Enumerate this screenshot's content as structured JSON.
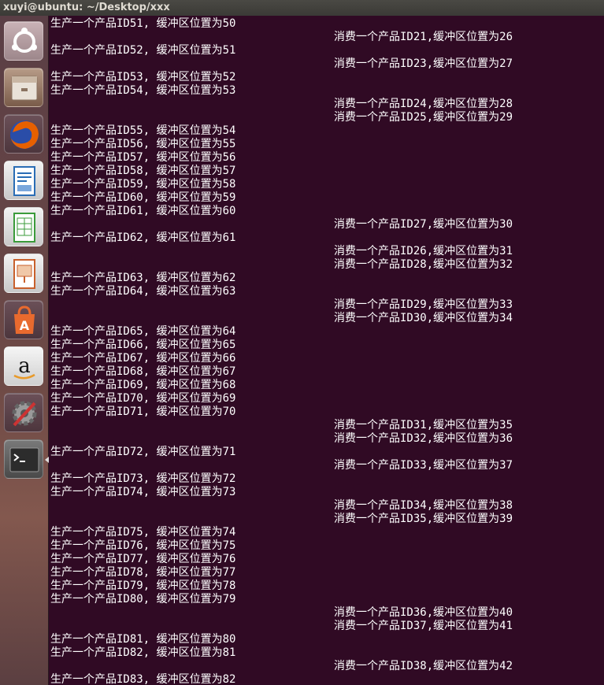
{
  "window": {
    "title": "xuyi@ubuntu: ~/Desktop/xxx"
  },
  "launcher": {
    "items": [
      {
        "name": "ubuntu-dash-icon",
        "color": "#b9a3a6"
      },
      {
        "name": "files-icon",
        "color": "#8a6d5b"
      },
      {
        "name": "firefox-icon",
        "color": "#e66000"
      },
      {
        "name": "writer-icon",
        "color": "#2a6db5"
      },
      {
        "name": "calc-icon",
        "color": "#3b9b3b"
      },
      {
        "name": "impress-icon",
        "color": "#c8602c"
      },
      {
        "name": "software-center-icon",
        "color": "#e86a2e"
      },
      {
        "name": "amazon-icon",
        "color": "#dddddd"
      },
      {
        "name": "system-settings-icon",
        "color": "#888888"
      },
      {
        "name": "terminal-icon",
        "color": "#333333"
      }
    ]
  },
  "terminal": {
    "colors": {
      "background": "#300a24",
      "text": "#ffffff"
    },
    "lines": [
      {
        "side": "producer",
        "row": 0,
        "text": "生产一个产品ID51, 缓冲区位置为50"
      },
      {
        "side": "consumer",
        "row": 1,
        "text": "消费一个产品ID21,缓冲区位置为26"
      },
      {
        "side": "producer",
        "row": 2,
        "text": "生产一个产品ID52, 缓冲区位置为51"
      },
      {
        "side": "consumer",
        "row": 3,
        "text": "消费一个产品ID23,缓冲区位置为27"
      },
      {
        "side": "producer",
        "row": 4,
        "text": "生产一个产品ID53, 缓冲区位置为52"
      },
      {
        "side": "producer",
        "row": 5,
        "text": "生产一个产品ID54, 缓冲区位置为53"
      },
      {
        "side": "consumer",
        "row": 6,
        "text": "消费一个产品ID24,缓冲区位置为28"
      },
      {
        "side": "consumer",
        "row": 7,
        "text": "消费一个产品ID25,缓冲区位置为29"
      },
      {
        "side": "producer",
        "row": 8,
        "text": "生产一个产品ID55, 缓冲区位置为54"
      },
      {
        "side": "producer",
        "row": 9,
        "text": "生产一个产品ID56, 缓冲区位置为55"
      },
      {
        "side": "producer",
        "row": 10,
        "text": "生产一个产品ID57, 缓冲区位置为56"
      },
      {
        "side": "producer",
        "row": 11,
        "text": "生产一个产品ID58, 缓冲区位置为57"
      },
      {
        "side": "producer",
        "row": 12,
        "text": "生产一个产品ID59, 缓冲区位置为58"
      },
      {
        "side": "producer",
        "row": 13,
        "text": "生产一个产品ID60, 缓冲区位置为59"
      },
      {
        "side": "producer",
        "row": 14,
        "text": "生产一个产品ID61, 缓冲区位置为60"
      },
      {
        "side": "consumer",
        "row": 15,
        "text": "消费一个产品ID27,缓冲区位置为30"
      },
      {
        "side": "producer",
        "row": 16,
        "text": "生产一个产品ID62, 缓冲区位置为61"
      },
      {
        "side": "consumer",
        "row": 17,
        "text": "消费一个产品ID26,缓冲区位置为31"
      },
      {
        "side": "consumer",
        "row": 18,
        "text": "消费一个产品ID28,缓冲区位置为32"
      },
      {
        "side": "producer",
        "row": 19,
        "text": "生产一个产品ID63, 缓冲区位置为62"
      },
      {
        "side": "producer",
        "row": 20,
        "text": "生产一个产品ID64, 缓冲区位置为63"
      },
      {
        "side": "consumer",
        "row": 21,
        "text": "消费一个产品ID29,缓冲区位置为33"
      },
      {
        "side": "consumer",
        "row": 22,
        "text": "消费一个产品ID30,缓冲区位置为34"
      },
      {
        "side": "producer",
        "row": 23,
        "text": "生产一个产品ID65, 缓冲区位置为64"
      },
      {
        "side": "producer",
        "row": 24,
        "text": "生产一个产品ID66, 缓冲区位置为65"
      },
      {
        "side": "producer",
        "row": 25,
        "text": "生产一个产品ID67, 缓冲区位置为66"
      },
      {
        "side": "producer",
        "row": 26,
        "text": "生产一个产品ID68, 缓冲区位置为67"
      },
      {
        "side": "producer",
        "row": 27,
        "text": "生产一个产品ID69, 缓冲区位置为68"
      },
      {
        "side": "producer",
        "row": 28,
        "text": "生产一个产品ID70, 缓冲区位置为69"
      },
      {
        "side": "producer",
        "row": 29,
        "text": "生产一个产品ID71, 缓冲区位置为70"
      },
      {
        "side": "consumer",
        "row": 30,
        "text": "消费一个产品ID31,缓冲区位置为35"
      },
      {
        "side": "consumer",
        "row": 31,
        "text": "消费一个产品ID32,缓冲区位置为36"
      },
      {
        "side": "producer",
        "row": 32,
        "text": "生产一个产品ID72, 缓冲区位置为71"
      },
      {
        "side": "consumer",
        "row": 33,
        "text": "消费一个产品ID33,缓冲区位置为37"
      },
      {
        "side": "producer",
        "row": 34,
        "text": "生产一个产品ID73, 缓冲区位置为72"
      },
      {
        "side": "producer",
        "row": 35,
        "text": "生产一个产品ID74, 缓冲区位置为73"
      },
      {
        "side": "consumer",
        "row": 36,
        "text": "消费一个产品ID34,缓冲区位置为38"
      },
      {
        "side": "consumer",
        "row": 37,
        "text": "消费一个产品ID35,缓冲区位置为39"
      },
      {
        "side": "producer",
        "row": 38,
        "text": "生产一个产品ID75, 缓冲区位置为74"
      },
      {
        "side": "producer",
        "row": 39,
        "text": "生产一个产品ID76, 缓冲区位置为75"
      },
      {
        "side": "producer",
        "row": 40,
        "text": "生产一个产品ID77, 缓冲区位置为76"
      },
      {
        "side": "producer",
        "row": 41,
        "text": "生产一个产品ID78, 缓冲区位置为77"
      },
      {
        "side": "producer",
        "row": 42,
        "text": "生产一个产品ID79, 缓冲区位置为78"
      },
      {
        "side": "producer",
        "row": 43,
        "text": "生产一个产品ID80, 缓冲区位置为79"
      },
      {
        "side": "consumer",
        "row": 44,
        "text": "消费一个产品ID36,缓冲区位置为40"
      },
      {
        "side": "consumer",
        "row": 45,
        "text": "消费一个产品ID37,缓冲区位置为41"
      },
      {
        "side": "producer",
        "row": 46,
        "text": "生产一个产品ID81, 缓冲区位置为80"
      },
      {
        "side": "producer",
        "row": 47,
        "text": "生产一个产品ID82, 缓冲区位置为81"
      },
      {
        "side": "consumer",
        "row": 48,
        "text": "消费一个产品ID38,缓冲区位置为42"
      },
      {
        "side": "producer",
        "row": 49,
        "text": "生产一个产品ID83, 缓冲区位置为82"
      }
    ]
  }
}
